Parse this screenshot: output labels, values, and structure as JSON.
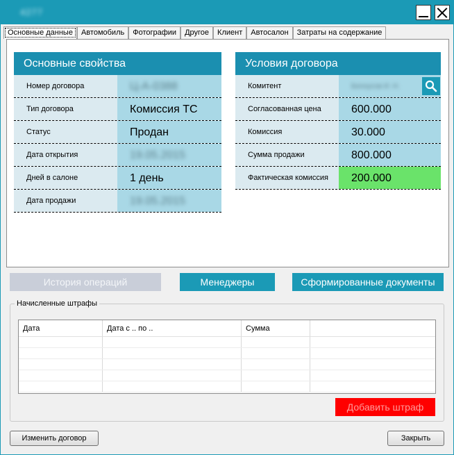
{
  "window": {
    "title": "4277"
  },
  "tabs": [
    {
      "label": "Основные данные",
      "active": true
    },
    {
      "label": "Автомобиль"
    },
    {
      "label": "Фотографии"
    },
    {
      "label": "Другое"
    },
    {
      "label": "Клиент"
    },
    {
      "label": "Автосалон"
    },
    {
      "label": "Затраты на содержание"
    }
  ],
  "basic": {
    "header": "Основные свойства",
    "rows": [
      {
        "label": "Номер договора",
        "value": "Ц-А-0388"
      },
      {
        "label": "Тип договора",
        "value": "Комиссия ТС"
      },
      {
        "label": "Статус",
        "value": "Продан"
      },
      {
        "label": "Дата открытия",
        "value": "19.05.2015"
      },
      {
        "label": "Дней в салоне",
        "value": "1 день"
      },
      {
        "label": "Дата продажи",
        "value": "19.05.2015"
      }
    ]
  },
  "contract": {
    "header": "Условия договора",
    "rows": [
      {
        "label": "Комитент",
        "value": "Белоусов И. Н."
      },
      {
        "label": "Согласованная цена",
        "value": "600.000"
      },
      {
        "label": "Комиссия",
        "value": "30.000"
      },
      {
        "label": "Сумма продажи",
        "value": "800.000"
      },
      {
        "label": "Фактическая комиссия",
        "value": "200.000"
      }
    ]
  },
  "actions": {
    "history": "История операций",
    "managers": "Менеджеры",
    "documents": "Сформированные документы"
  },
  "fines": {
    "legend": "Начисленные штрафы",
    "columns": [
      "Дата",
      "Дата с .. по ..",
      "Сумма",
      ""
    ],
    "add_label": "Добавить штраф"
  },
  "footer": {
    "change_label": "Изменить договор",
    "close_label": "Закрыть"
  },
  "colors": {
    "accent": "#1b9ab6",
    "header": "#1b8fb0",
    "highlight": "#6ae36a",
    "danger": "#ff0000"
  }
}
